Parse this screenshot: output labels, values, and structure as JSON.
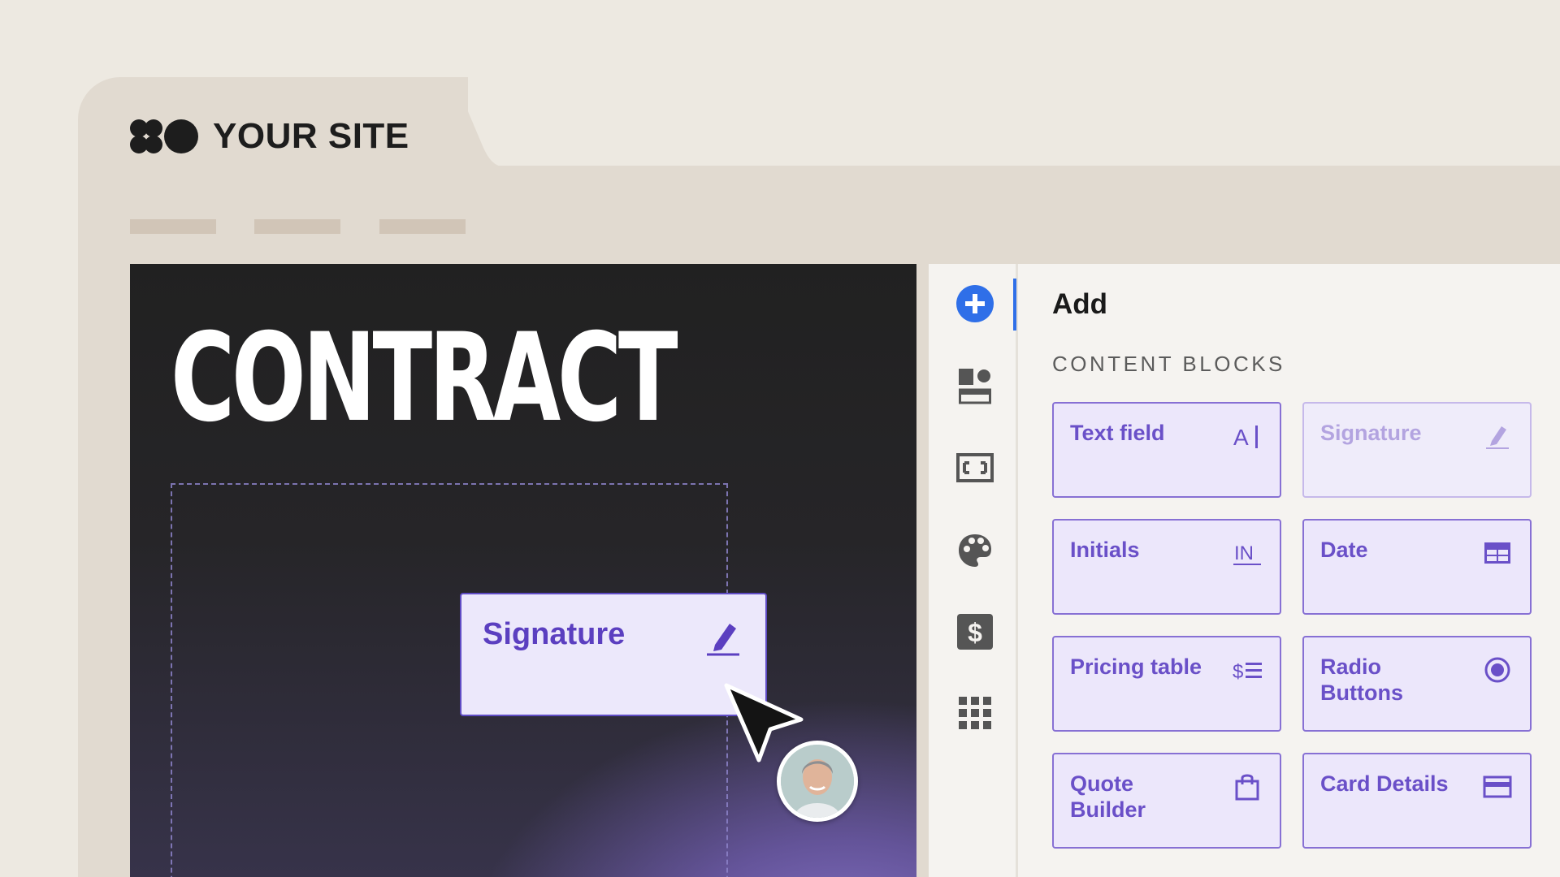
{
  "site": {
    "logo_text": "YOUR SITE",
    "logo_icon": "clover-circle-logo",
    "nav_items": [
      "",
      "",
      ""
    ]
  },
  "canvas": {
    "title": "CONTRACT",
    "dragged_block": {
      "label": "Signature",
      "icon": "pen-sign-icon"
    },
    "user_avatar": "user-avatar"
  },
  "panel": {
    "title": "Add",
    "section_label": "CONTENT BLOCKS",
    "rail": [
      {
        "icon": "add-icon",
        "active": true
      },
      {
        "icon": "layout-icon"
      },
      {
        "icon": "media-icon"
      },
      {
        "icon": "palette-icon"
      },
      {
        "icon": "dollar-icon"
      },
      {
        "icon": "grid-icon"
      }
    ],
    "blocks": [
      {
        "label": "Text field",
        "icon": "text-cursor-icon",
        "disabled": false
      },
      {
        "label": "Signature",
        "icon": "pen-sign-icon",
        "disabled": true
      },
      {
        "label": "Initials",
        "icon": "initials-icon",
        "disabled": false
      },
      {
        "label": "Date",
        "icon": "calendar-table-icon",
        "disabled": false
      },
      {
        "label": "Pricing table",
        "icon": "price-list-icon",
        "disabled": false
      },
      {
        "label": "Radio Buttons",
        "icon": "radio-icon",
        "disabled": false
      },
      {
        "label": "Quote Builder",
        "icon": "bag-icon",
        "disabled": false
      },
      {
        "label": "Card Details",
        "icon": "credit-card-icon",
        "disabled": false
      }
    ]
  },
  "colors": {
    "background": "#ede9e1",
    "window": "#e1dad0",
    "accent": "#6a50c8",
    "rail_active": "#2f6fe8"
  }
}
